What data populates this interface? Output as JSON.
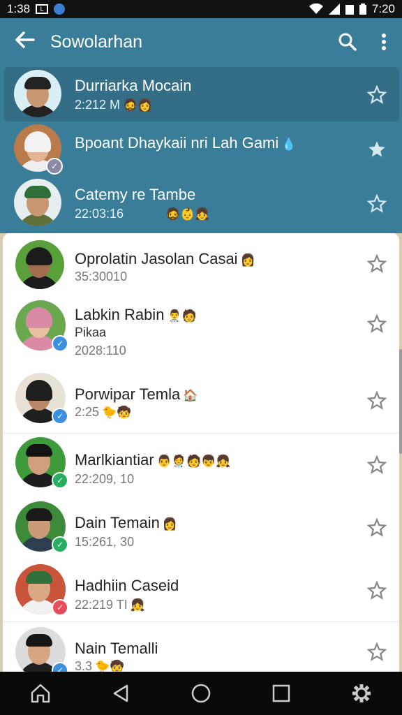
{
  "status_bar": {
    "time_left": "1:38",
    "time_right": "7:20"
  },
  "app_bar": {
    "title": "Sowolarhan"
  },
  "top_contacts": [
    {
      "name": "Durriarka Mocain",
      "sub": "2:212 M",
      "emoji": "🧔👩",
      "starred": false,
      "highlighted": true
    },
    {
      "name": "Bpoant Dhaykaii nri Lah Gami",
      "sub": "",
      "emoji": "💧",
      "starred": true
    },
    {
      "name": "Catemy re Tambe",
      "sub": "22:03:16",
      "emoji": "🧔👶👧",
      "starred": false
    }
  ],
  "contacts": [
    {
      "name": "Oprolatin Jasolan Casai",
      "name_emoji": "👩",
      "sub": "35:30010",
      "sub_emoji": "",
      "extra": ""
    },
    {
      "name": "Labkin Rabin",
      "name_emoji": "👨‍⚕️🧑",
      "extra": "Pikaa",
      "sub": "2028:110",
      "sub_emoji": ""
    },
    {
      "name": "Porwipar Temla",
      "name_emoji": "🏠",
      "sub": "2:25",
      "sub_emoji": "🐤🧒",
      "extra": ""
    },
    {
      "name": "Marlkiantiar",
      "name_emoji": "👨🧑‍⚕️🧑👦👧",
      "sub": "22:209, 10",
      "sub_emoji": "",
      "extra": ""
    },
    {
      "name": "Dain Temain",
      "name_emoji": "👩",
      "sub": "15:261, 30",
      "sub_emoji": "",
      "extra": ""
    },
    {
      "name": "Hadhiin Caseid",
      "name_emoji": "",
      "sub": "22:219 TI",
      "sub_emoji": "👧",
      "extra": ""
    },
    {
      "name": "Nain Temalli",
      "name_emoji": "",
      "sub": "3.3",
      "sub_emoji": "🐤🧒",
      "extra": ""
    }
  ],
  "colors": {
    "primary": "#3a7d99",
    "badge_blue": "#3d8fe0",
    "badge_green": "#27ae60",
    "badge_red": "#e74c5a"
  }
}
